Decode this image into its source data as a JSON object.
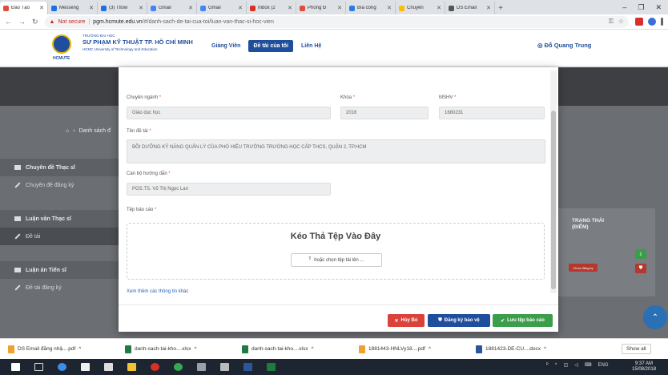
{
  "browser": {
    "tabs": [
      {
        "title": "Đào Tạo",
        "color": "#e24b3b",
        "active": true
      },
      {
        "title": "Messeng",
        "color": "#1e6fe1"
      },
      {
        "title": "(3) Ttlow",
        "color": "#1e6fe1"
      },
      {
        "title": "Gmail",
        "color": "#4285f4"
      },
      {
        "title": "Gmail",
        "color": "#4285f4"
      },
      {
        "title": "Inbox (2",
        "color": "#d93025"
      },
      {
        "title": "Phòng Đ",
        "color": "#e24b3b"
      },
      {
        "title": "Bìa công",
        "color": "#2b7be0"
      },
      {
        "title": "Chuyển",
        "color": "#fbbc04"
      },
      {
        "title": "DS Email",
        "color": "#555555"
      }
    ],
    "new_tab": "+",
    "not_secure": "Not secure",
    "url_host": "pgm.hcmute.edu.vn",
    "url_path": "/#/danh-sach-de-tai-cua-toi/luan-van-thac-si-hoc-vien"
  },
  "site": {
    "logo_text": "HCMUTE",
    "uni_small": "TRƯỜNG ĐẠI HỌC",
    "uni_name": "SƯ PHẠM KỸ THUẬT TP. HỒ CHÍ MINH",
    "uni_en": "HCMC University of Technology and Education",
    "nav": {
      "lecturer": "Giảng Viên",
      "my_topics": "Đề tài của tôi",
      "contact": "Liên Hệ"
    },
    "user": "Đỗ Quang Trung"
  },
  "page": {
    "breadcrumb": "Danh sách đ",
    "sidebar": {
      "thesis_topics": "Chuyên đề Thạc sĩ",
      "registered_topics": "Chuyên đề đăng ký",
      "master_thesis": "Luận văn Thạc sĩ",
      "topic": "Đề tài",
      "phd_thesis": "Luận án Tiến sĩ",
      "registered_theses": "Đề tài đăng ký"
    },
    "status_header": "TRẠNG THÁI (ĐIỂM)",
    "status_pill": "Chưa đăng ký"
  },
  "modal": {
    "major_label": "Chuyên ngành",
    "major_value": "Giáo dục học",
    "course_label": "Khóa",
    "course_value": "2016",
    "student_id_label": "MSHV",
    "student_id_value": "1680231",
    "title_label": "Tên đề tài",
    "title_value": "BỒI DƯỠNG KỸ NĂNG QUẢN LÝ CỦA PHÓ HIỆU TRƯỞNG TRƯỜNG HỌC CẤP THCS, QUẬN 2, TP.HCM",
    "advisor_label": "Cán bộ hướng dẫn",
    "advisor_value": "PGS.TS. Võ Thị Ngọc Lan",
    "report_label": "Tệp báo cáo",
    "dropzone_title": "Kéo Thả Tệp Vào Đây",
    "choose_file": "hoặc chọn tệp tải lên ...",
    "more_info": "Xem thêm các thông tin khác",
    "cancel": "Hủy Bỏ",
    "register": "Đăng ký bảo vệ",
    "save": "Lưu tệp báo cáo"
  },
  "downloads": [
    {
      "name": "DS Email đăng nhậ....pdf",
      "color": "#f0a030"
    },
    {
      "name": "danh-sach-tai-kho....xlsx",
      "color": "#1f7a43"
    },
    {
      "name": "danh-sach-tai-kho....xlsx",
      "color": "#1f7a43"
    },
    {
      "name": "1881443-HNLVy18....pdf",
      "color": "#f0a030"
    },
    {
      "name": "1881423-DE-CU....docx",
      "color": "#2b579a"
    }
  ],
  "show_all": "Show all",
  "taskbar": {
    "lang": "ENG",
    "time": "9:37 AM",
    "date": "15/08/2018"
  }
}
